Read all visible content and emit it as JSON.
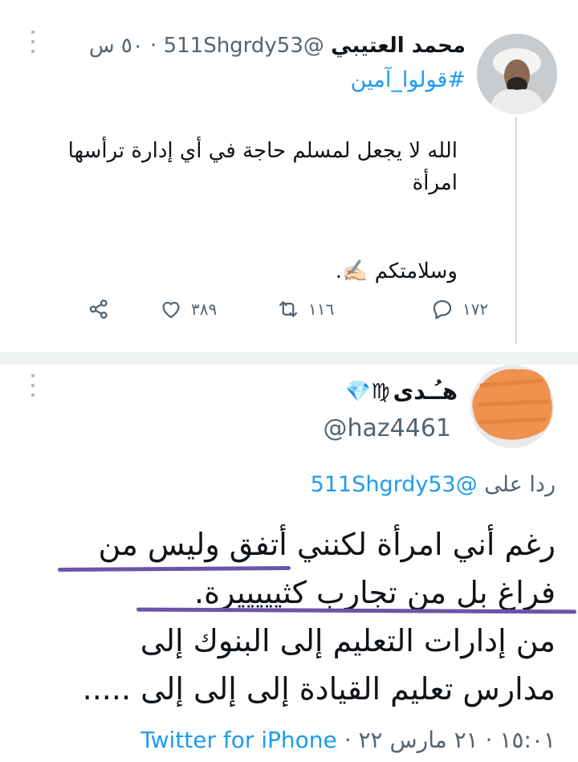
{
  "tweet1": {
    "display_name": "محمد العتيبي",
    "handle": "@511Shgrdy53",
    "time": "٥٠ س",
    "hashtag": "#قولوا_آمين",
    "text": "الله لا يجعل لمسلم حاجة في أي إدارة ترأسها امرأة",
    "signoff": "وسلامتكم ✍🏻.",
    "actions": {
      "reply_count": "١٧٢",
      "retweet_count": "١١٦",
      "like_count": "٣٨٩"
    }
  },
  "tweet2": {
    "display_name": "هـُـدى",
    "name_emojis": "♍💎",
    "handle": "@haz4461",
    "replying_prefix": "ردا على",
    "replying_to": "@511Shgrdy53",
    "text_line1": "رغم أني امرأة لكنني أتفق وليس من",
    "text_line2": "فراغ بل من تجارب كثيييييرة.",
    "text_line3": "من إدارات التعليم إلى البنوك إلى",
    "text_line4": "مدارس تعليم القيادة إلى إلى إلى .....",
    "timestamp": "١٥:٠١ · ٢١ مارس ٢٢ ·",
    "source": "Twitter for iPhone"
  },
  "colors": {
    "accent": "#1d9bf0",
    "muted": "#536471",
    "scribble": "#f0924f",
    "underline": "#6a55a8"
  }
}
